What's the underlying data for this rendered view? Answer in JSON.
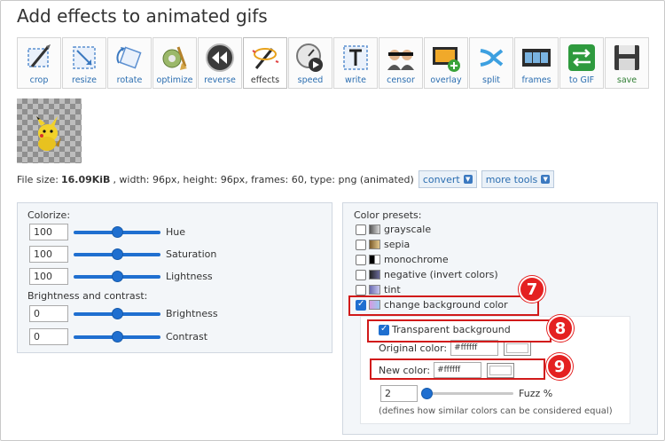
{
  "title": "Add effects to animated gifs",
  "toolbar": [
    {
      "label": "crop",
      "icon": "crop-icon"
    },
    {
      "label": "resize",
      "icon": "resize-icon"
    },
    {
      "label": "rotate",
      "icon": "rotate-icon"
    },
    {
      "label": "optimize",
      "icon": "optimize-icon"
    },
    {
      "label": "reverse",
      "icon": "reverse-icon"
    },
    {
      "label": "effects",
      "icon": "effects-icon",
      "active": true
    },
    {
      "label": "speed",
      "icon": "speed-icon"
    },
    {
      "label": "write",
      "icon": "write-icon"
    },
    {
      "label": "censor",
      "icon": "censor-icon"
    },
    {
      "label": "overlay",
      "icon": "overlay-icon"
    },
    {
      "label": "split",
      "icon": "split-icon"
    },
    {
      "label": "frames",
      "icon": "frames-icon"
    },
    {
      "label": "to GIF",
      "icon": "to-gif-icon"
    },
    {
      "label": "save",
      "icon": "save-icon"
    }
  ],
  "fileinfo": {
    "prefix": "File size:",
    "size": "16.09KiB",
    "details": ", width: 96px, height: 96px, frames: 60, type: png (animated)",
    "convert": "convert",
    "more_tools": "more tools"
  },
  "colorize": {
    "title": "Colorize:",
    "hue": {
      "value": "100",
      "label": "Hue",
      "level": 0.5
    },
    "saturation": {
      "value": "100",
      "label": "Saturation",
      "level": 0.5
    },
    "lightness": {
      "value": "100",
      "label": "Lightness",
      "level": 0.5
    }
  },
  "brightness": {
    "title": "Brightness and contrast:",
    "brightness": {
      "value": "0",
      "label": "Brightness",
      "level": 0.5
    },
    "contrast": {
      "value": "0",
      "label": "Contrast",
      "level": 0.5
    }
  },
  "presets": {
    "title": "Color presets:",
    "items": [
      {
        "label": "grayscale",
        "checked": false
      },
      {
        "label": "sepia",
        "checked": false
      },
      {
        "label": "monochrome",
        "checked": false
      },
      {
        "label": "negative (invert colors)",
        "checked": false
      },
      {
        "label": "tint",
        "checked": false
      },
      {
        "label": "change background color",
        "checked": true
      }
    ]
  },
  "bgcolor": {
    "transparent_label": "Transparent background",
    "original_label": "Original color:",
    "original_value": "#ffffff",
    "new_label": "New color:",
    "new_value": "#ffffff",
    "fuzz_value": "2",
    "fuzz_label": "Fuzz %",
    "fuzz_level": 0.02,
    "note": "(defines how similar colors can be considered equal)"
  },
  "callouts": {
    "b7": "7",
    "b8": "8",
    "b9": "9"
  },
  "colors": {
    "accent": "#1f6fd0",
    "callout": "#e42121",
    "link": "#2a6db0"
  }
}
